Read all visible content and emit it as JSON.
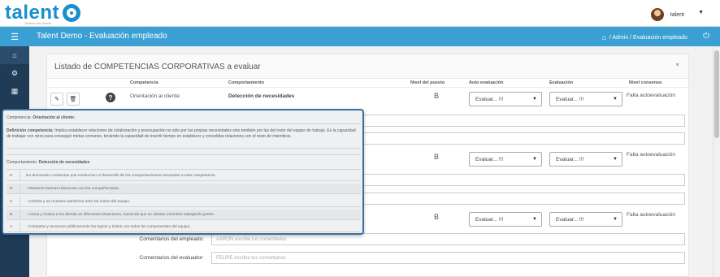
{
  "app": {
    "logo_text": "talent",
    "logo_tagline": "Gestión del talento",
    "user_name": "talent",
    "page_title": "Talent Demo - Evaluación empleado",
    "breadcrumb": "/ Admin / Evaluación empleado"
  },
  "sidebar": {
    "icons": [
      "home-icon",
      "gear-icon",
      "building-icon"
    ]
  },
  "panel": {
    "title": "Listado de COMPETENCIAS CORPORATIVAS a evaluar",
    "columns": {
      "competencia": "Competencia",
      "comportamiento": "Comportamiento",
      "nivel": "Nivel del puesto",
      "auto": "Auto evaluación",
      "evaluacion": "Evaluación",
      "consenso": "Nivel consenso"
    },
    "rows": [
      {
        "competencia": "Orientación al cliente:",
        "comportamiento": "Detección de necesidades",
        "nivel": "B",
        "auto_select": "Evaluar... !!!",
        "eval_select": "Evaluar... !!!",
        "status": "Falta autoevaluación"
      },
      {
        "nivel": "B",
        "auto_select": "Evaluar... !!!",
        "eval_select": "Evaluar... !!!",
        "status": "Falta autoevaluación"
      },
      {
        "nivel": "B",
        "auto_select": "Evaluar... !!!",
        "eval_select": "Evaluar... !!!",
        "status": "Falta autoevaluación"
      }
    ],
    "comments": {
      "empleado_label": "Comentarios del empleado:",
      "empleado_placeholder": "AARON escribe tus comentarios",
      "evaluador_label": "Comentarios del evaluador:",
      "evaluador_placeholder": "FELIPE escribe tus comentarios"
    }
  },
  "popup": {
    "competencia_prefix": "Competencia:",
    "competencia_name": "Orientación al cliente:",
    "definicion_label": "Definición competencia:",
    "definicion_text": "Implica establecer relaciones de colaboración y preocupación no sólo por las propias necesidades sino también por las del resto del equipo de trabajo. Es la capacidad de trabajar con otros para conseguir metas comunes, teniendo la capacidad de invertir tiempo en establecer y consolidar relaciones con el resto de miembros.",
    "comportamiento_prefix": "Comportamiento:",
    "comportamiento_name": "Detección de necesidades",
    "levels": [
      {
        "level": "E",
        "text": "No demuestra conductas que evidencien el desarrollo de los comportamientos asociados a esta competencia"
      },
      {
        "level": "D",
        "text": "- Mantiene buenas relaciones con los compañeros/as."
      },
      {
        "level": "C",
        "text": "- Celebra y se muestra satisfecho ante los éxitos del equipo."
      },
      {
        "level": "B",
        "text": "- Anima y motiva a los demás en diferentes situaciones, haciendo que se sientan cómodos trabajando juntos."
      },
      {
        "level": "A",
        "text": "- Comparte y reconoce públicamente los logros y éxitos con todos los componentes del equipo."
      }
    ]
  }
}
